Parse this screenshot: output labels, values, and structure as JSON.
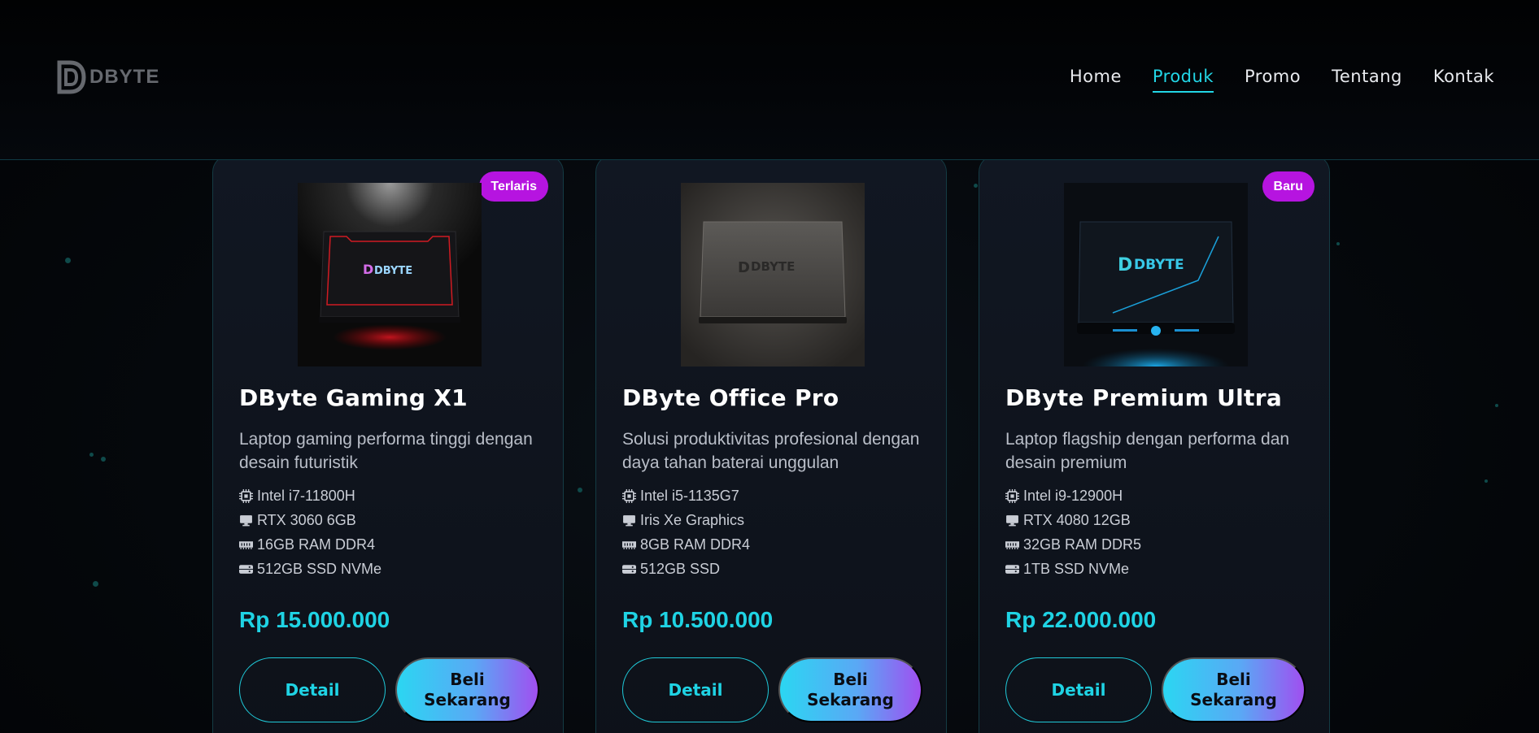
{
  "brand": {
    "name": "DBYTE"
  },
  "nav": {
    "items": [
      {
        "label": "Home"
      },
      {
        "label": "Produk"
      },
      {
        "label": "Promo"
      },
      {
        "label": "Tentang"
      },
      {
        "label": "Kontak"
      }
    ],
    "active_index": 1
  },
  "colors": {
    "accent": "#1fd3e4",
    "badge": "#b614e0",
    "buy_gradient_start": "#2bd6f2",
    "buy_gradient_end": "#a04ff0"
  },
  "products": [
    {
      "badge": "Terlaris",
      "image_logo": "DBYTE",
      "title": "DByte Gaming X1",
      "description": "Laptop gaming performa tinggi dengan desain futuristik",
      "specs": [
        {
          "icon": "cpu-icon",
          "text": "Intel i7-11800H"
        },
        {
          "icon": "monitor-icon",
          "text": "RTX 3060 6GB"
        },
        {
          "icon": "memory-icon",
          "text": "16GB RAM DDR4"
        },
        {
          "icon": "storage-icon",
          "text": "512GB SSD NVMe"
        }
      ],
      "price": "Rp 15.000.000",
      "detail_label": "Detail",
      "buy_label": "Beli Sekarang"
    },
    {
      "badge": "",
      "image_logo": "DBYTE",
      "title": "DByte Office Pro",
      "description": "Solusi produktivitas profesional dengan daya tahan baterai unggulan",
      "specs": [
        {
          "icon": "cpu-icon",
          "text": "Intel i5-1135G7"
        },
        {
          "icon": "monitor-icon",
          "text": "Iris Xe Graphics"
        },
        {
          "icon": "memory-icon",
          "text": "8GB RAM DDR4"
        },
        {
          "icon": "storage-icon",
          "text": "512GB SSD"
        }
      ],
      "price": "Rp 10.500.000",
      "detail_label": "Detail",
      "buy_label": "Beli Sekarang"
    },
    {
      "badge": "Baru",
      "image_logo": "DBYTE",
      "title": "DByte Premium Ultra",
      "description": "Laptop flagship dengan performa dan desain premium",
      "specs": [
        {
          "icon": "cpu-icon",
          "text": "Intel i9-12900H"
        },
        {
          "icon": "monitor-icon",
          "text": "RTX 4080 12GB"
        },
        {
          "icon": "memory-icon",
          "text": "32GB RAM DDR5"
        },
        {
          "icon": "storage-icon",
          "text": "1TB SSD NVMe"
        }
      ],
      "price": "Rp 22.000.000",
      "detail_label": "Detail",
      "buy_label": "Beli Sekarang"
    }
  ]
}
